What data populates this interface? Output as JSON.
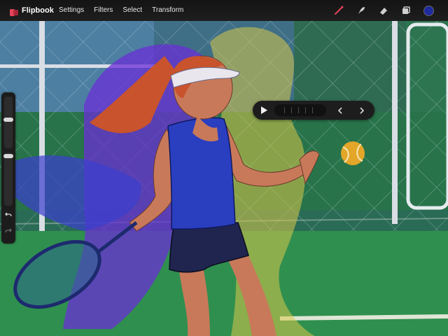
{
  "app": {
    "name": "Flipbook",
    "logo_icon": "flipbook-logo-icon"
  },
  "menu": [
    "Settings",
    "Filters",
    "Select",
    "Transform"
  ],
  "tools": [
    {
      "name": "brush-icon",
      "active": true
    },
    {
      "name": "smudge-icon"
    },
    {
      "name": "eraser-icon"
    },
    {
      "name": "layers-icon"
    },
    {
      "name": "color-swatch",
      "color": "#1f2a9e"
    }
  ],
  "sidebar": {
    "brush_size": 0.22,
    "opacity": 0.55,
    "undo_icon": "undo-icon",
    "redo_icon": "redo-icon"
  },
  "player": {
    "play_icon": "play-icon",
    "prev_icon": "chevron-left-icon",
    "next_icon": "chevron-right-icon"
  },
  "colors": {
    "accent": "#c0364a",
    "ui_bg": "#1d1d1d",
    "current_color": "#1f2a9e"
  }
}
